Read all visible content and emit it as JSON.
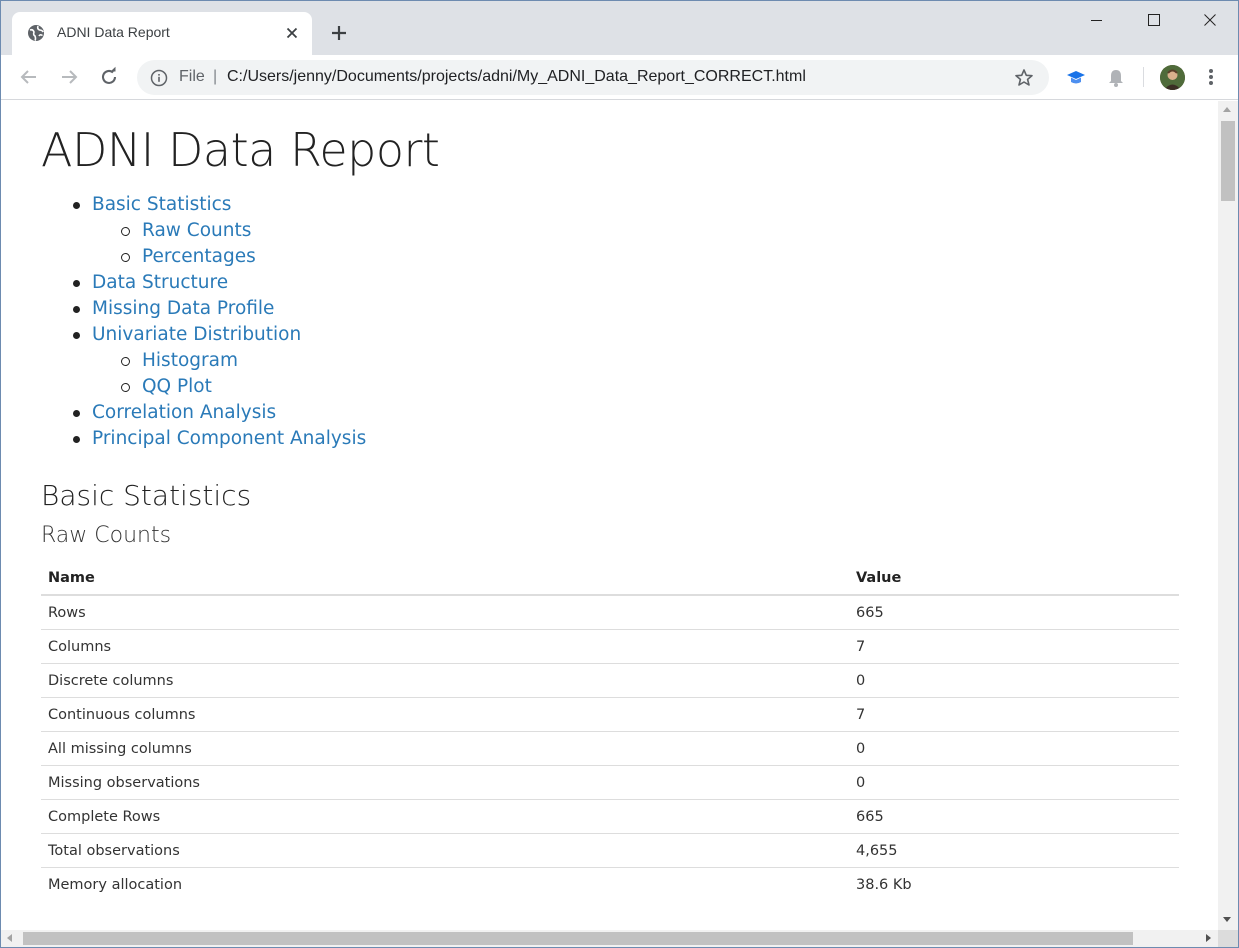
{
  "browser": {
    "tab_title": "ADNI Data Report",
    "omnibox": {
      "scheme_label": "File",
      "separator": "|",
      "url": "C:/Users/jenny/Documents/projects/adni/My_ADNI_Data_Report_CORRECT.html"
    },
    "icons": {
      "favicon": "globe-icon",
      "tab_close": "close-icon",
      "new_tab": "plus-icon",
      "back": "arrow-left-icon",
      "forward": "arrow-right-icon",
      "reload": "reload-icon",
      "site_info": "info-icon",
      "bookmark": "star-icon",
      "extension_1": "graduation-cap-icon",
      "extension_2": "bell-icon",
      "menu": "vertical-dots-icon"
    },
    "colors": {
      "tabstrip": "#dee1e6",
      "omnibox_bg": "#f1f3f4",
      "link": "#2a7ab8",
      "extension_blue": "#1a73e8"
    }
  },
  "page": {
    "title": "ADNI Data Report",
    "toc": [
      {
        "label": "Basic Statistics",
        "level": 1
      },
      {
        "label": "Raw Counts",
        "level": 2
      },
      {
        "label": "Percentages",
        "level": 2
      },
      {
        "label": "Data Structure",
        "level": 1
      },
      {
        "label": "Missing Data Profile",
        "level": 1
      },
      {
        "label": "Univariate Distribution",
        "level": 1
      },
      {
        "label": "Histogram",
        "level": 2
      },
      {
        "label": "QQ Plot",
        "level": 2
      },
      {
        "label": "Correlation Analysis",
        "level": 1
      },
      {
        "label": "Principal Component Analysis",
        "level": 1
      }
    ],
    "section_heading": "Basic Statistics",
    "subsection_heading": "Raw Counts",
    "table": {
      "headers": [
        "Name",
        "Value"
      ],
      "rows": [
        [
          "Rows",
          "665"
        ],
        [
          "Columns",
          "7"
        ],
        [
          "Discrete columns",
          "0"
        ],
        [
          "Continuous columns",
          "7"
        ],
        [
          "All missing columns",
          "0"
        ],
        [
          "Missing observations",
          "0"
        ],
        [
          "Complete Rows",
          "665"
        ],
        [
          "Total observations",
          "4,655"
        ],
        [
          "Memory allocation",
          "38.6 Kb"
        ]
      ]
    }
  }
}
